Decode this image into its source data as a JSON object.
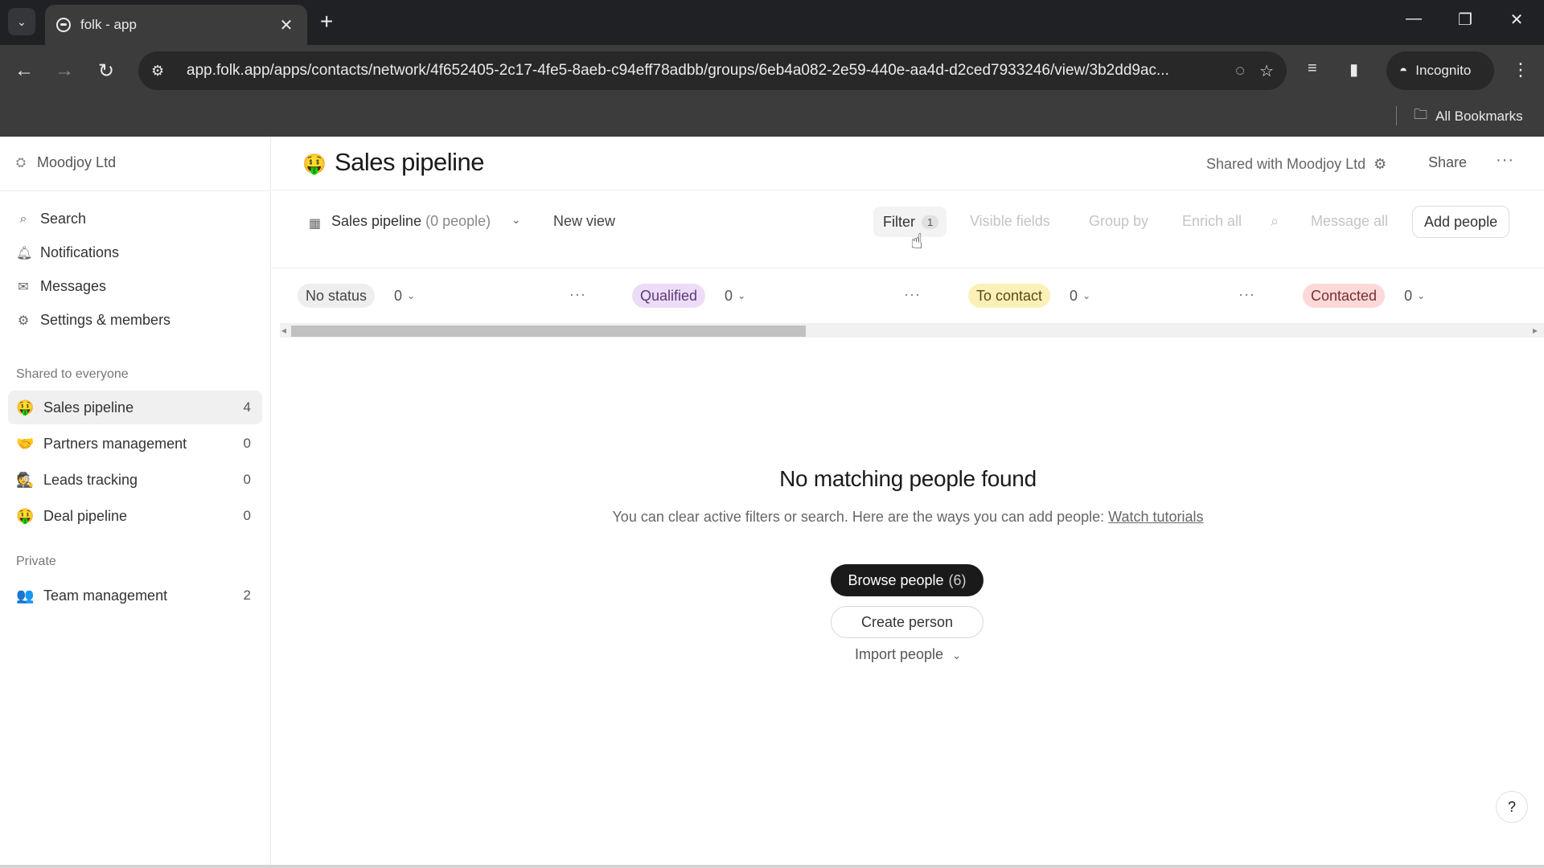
{
  "browser": {
    "tab_title": "folk - app",
    "url": "app.folk.app/apps/contacts/network/4f652405-2c17-4fe5-8aeb-c94eff78adbb/groups/6eb4a082-2e59-440e-aa4d-d2ced7933246/view/3b2dd9ac...",
    "incognito_label": "Incognito",
    "bookmarks_label": "All Bookmarks"
  },
  "sidebar": {
    "workspace": "Moodjoy Ltd",
    "nav": [
      {
        "label": "Search",
        "icon": "search-icon"
      },
      {
        "label": "Notifications",
        "icon": "bell-icon"
      },
      {
        "label": "Messages",
        "icon": "mail-icon"
      },
      {
        "label": "Settings & members",
        "icon": "gear-icon"
      }
    ],
    "shared_label": "Shared to everyone",
    "shared_groups": [
      {
        "emoji": "🤑",
        "label": "Sales pipeline",
        "count": "4"
      },
      {
        "emoji": "🤝",
        "label": "Partners management",
        "count": "0"
      },
      {
        "emoji": "🕵",
        "label": "Leads tracking",
        "count": "0"
      },
      {
        "emoji": "🤑",
        "label": "Deal pipeline",
        "count": "0"
      }
    ],
    "private_label": "Private",
    "private_groups": [
      {
        "emoji": "👥",
        "label": "Team management",
        "count": "2"
      }
    ]
  },
  "header": {
    "emoji": "🤑",
    "title": "Sales pipeline",
    "shared_with": "Shared with Moodjoy Ltd",
    "share_label": "Share"
  },
  "views_bar": {
    "view_name": "Sales pipeline",
    "view_count": "(0 people)",
    "new_view": "New view",
    "filter_label": "Filter",
    "filter_count": "1",
    "visible_fields": "Visible fields",
    "group_by": "Group by",
    "enrich_all": "Enrich all",
    "message_all": "Message all",
    "add_people": "Add people"
  },
  "columns": [
    {
      "label": "No status",
      "count": "0",
      "bg": "#eeeeee",
      "fg": "#444444"
    },
    {
      "label": "Qualified",
      "count": "0",
      "bg": "#eddcf7",
      "fg": "#5a3a78"
    },
    {
      "label": "To contact",
      "count": "0",
      "bg": "#fbf1b8",
      "fg": "#5a4a10"
    },
    {
      "label": "Contacted",
      "count": "0",
      "bg": "#fbd9d9",
      "fg": "#7a2e2e"
    }
  ],
  "empty_state": {
    "title": "No matching people found",
    "description": "You can clear active filters or search. Here are the ways you can add people:",
    "link": "Watch tutorials",
    "browse_label": "Browse people",
    "browse_count": "(6)",
    "create_label": "Create person",
    "import_label": "Import people"
  },
  "help_label": "?"
}
